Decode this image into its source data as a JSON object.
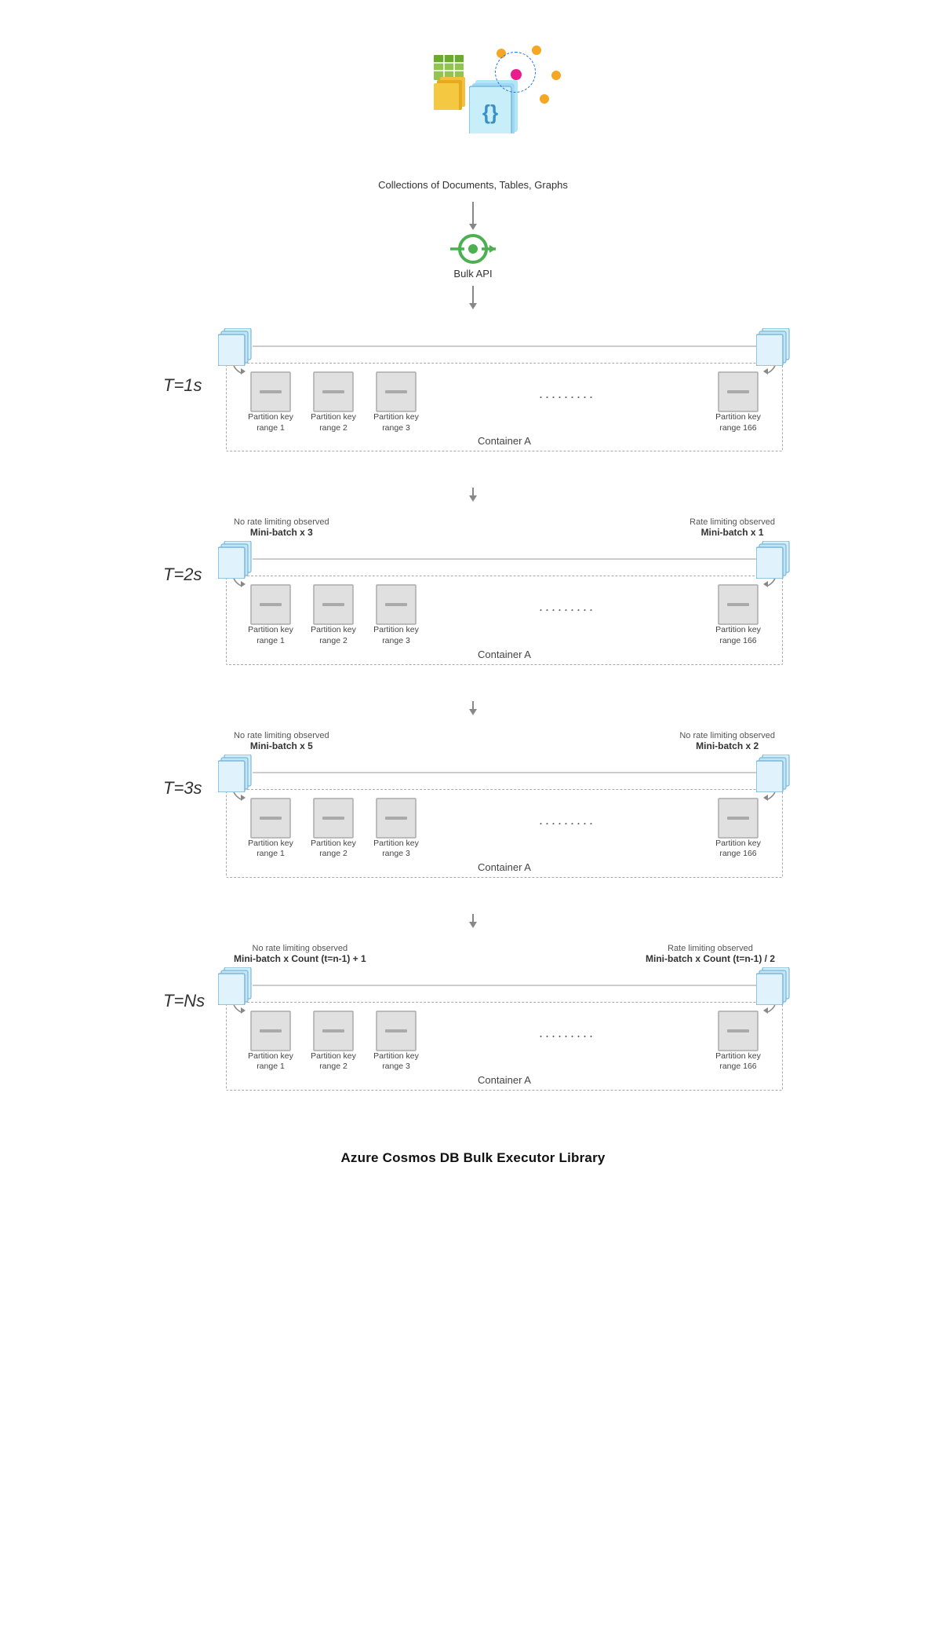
{
  "top": {
    "caption": "Collections of Documents, Tables, Graphs",
    "bulk_api_label": "Bulk API"
  },
  "times": [
    {
      "label": "T=1s",
      "left_note": null,
      "left_batch": null,
      "right_note": null,
      "right_batch": null,
      "partitions": [
        {
          "label": "Partition key\nrange 1"
        },
        {
          "label": "Partition key\nrange 2"
        },
        {
          "label": "Partition key\nrange 3"
        },
        {
          "label": "Partition key\nrange 166"
        }
      ],
      "container_label": "Container A"
    },
    {
      "label": "T=2s",
      "left_note": "No rate limiting observed",
      "left_batch": "Mini-batch x 3",
      "right_note": "Rate limiting observed",
      "right_batch": "Mini-batch x 1",
      "partitions": [
        {
          "label": "Partition key\nrange 1"
        },
        {
          "label": "Partition key\nrange 2"
        },
        {
          "label": "Partition key\nrange 3"
        },
        {
          "label": "Partition key\nrange 166"
        }
      ],
      "container_label": "Container A"
    },
    {
      "label": "T=3s",
      "left_note": "No rate limiting observed",
      "left_batch": "Mini-batch x 5",
      "right_note": "No rate limiting observed",
      "right_batch": "Mini-batch x 2",
      "partitions": [
        {
          "label": "Partition key\nrange 1"
        },
        {
          "label": "Partition key\nrange 2"
        },
        {
          "label": "Partition key\nrange 3"
        },
        {
          "label": "Partition key\nrange 166"
        }
      ],
      "container_label": "Container A"
    },
    {
      "label": "T=Ns",
      "left_note": "No rate limiting observed",
      "left_batch": "Mini-batch x Count (t=n-1) + 1",
      "right_note": "Rate limiting observed",
      "right_batch": "Mini-batch x Count (t=n-1) / 2",
      "partitions": [
        {
          "label": "Partition key\nrange 1"
        },
        {
          "label": "Partition key\nrange 2"
        },
        {
          "label": "Partition key\nrange 3"
        },
        {
          "label": "Partition key\nrange 166"
        }
      ],
      "container_label": "Container A"
    }
  ],
  "footer": "Azure Cosmos DB Bulk Executor Library"
}
